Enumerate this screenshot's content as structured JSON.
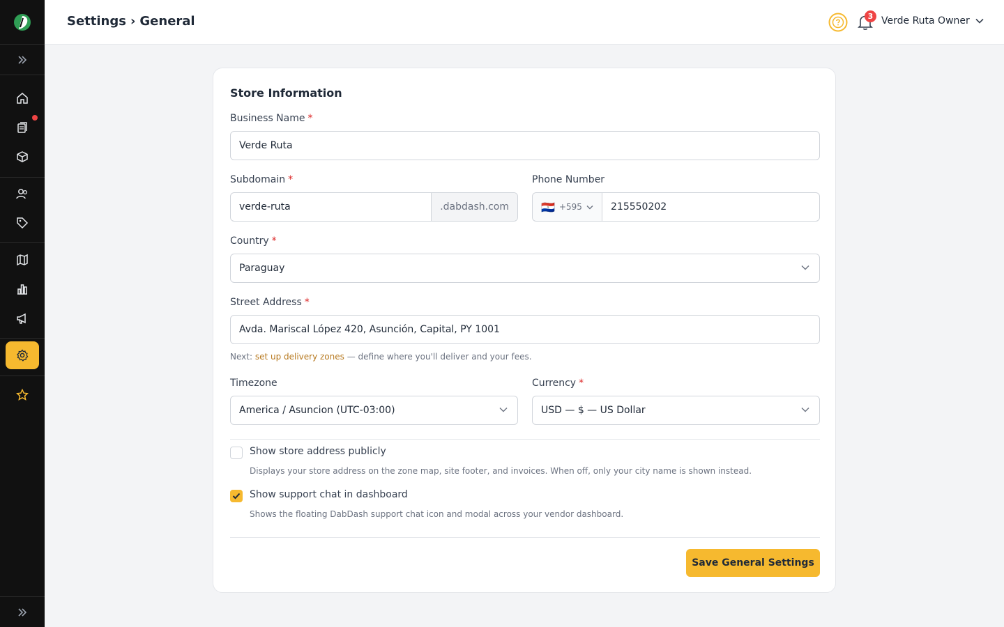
{
  "header": {
    "breadcrumb_section": "Settings",
    "breadcrumb_separator": "›",
    "breadcrumb_page": "General",
    "notification_count": "3",
    "user_name": "Verde Ruta Owner"
  },
  "sidebar": {
    "items": [
      {
        "icon": "home-icon"
      },
      {
        "icon": "orders-icon",
        "has_alert": true
      },
      {
        "icon": "box-icon"
      },
      {
        "icon": "users-icon"
      },
      {
        "icon": "tag-icon"
      },
      {
        "icon": "map-icon"
      },
      {
        "icon": "chart-icon"
      },
      {
        "icon": "megaphone-icon"
      },
      {
        "icon": "gear-icon",
        "active": true
      },
      {
        "icon": "star-icon"
      }
    ]
  },
  "form": {
    "section_title": "Store Information",
    "required_marker": "*",
    "business_name": {
      "label": "Business Name",
      "value": "Verde Ruta"
    },
    "subdomain": {
      "label": "Subdomain",
      "value": "verde-ruta",
      "suffix": ".dabdash.com"
    },
    "phone": {
      "label": "Phone Number",
      "flag": "🇵🇾",
      "code": "+595",
      "value": "215550202"
    },
    "country": {
      "label": "Country",
      "value": "Paraguay"
    },
    "street_address": {
      "label": "Street Address",
      "value": "Avda. Mariscal López 420, Asunción, Capital, PY 1001"
    },
    "hint": {
      "prefix": "Next: ",
      "link": "set up delivery zones",
      "suffix": " — define where you'll deliver and your fees."
    },
    "timezone": {
      "label": "Timezone",
      "value": "America / Asuncion (UTC-03:00)"
    },
    "currency": {
      "label": "Currency",
      "value": "USD — $ — US Dollar"
    },
    "show_address": {
      "label": "Show store address publicly",
      "checked": false,
      "description": "Displays your store address on the zone map, site footer, and invoices. When off, only your city name is shown instead."
    },
    "show_support_chat": {
      "label": "Show support chat in dashboard",
      "checked": true,
      "description": "Shows the floating DabDash support chat icon and modal across your vendor dashboard."
    },
    "save_label": "Save General Settings"
  },
  "colors": {
    "accent": "#f6b92f",
    "sidebar_bg": "#111111",
    "required": "#dc2626",
    "link": "#b7791f"
  }
}
